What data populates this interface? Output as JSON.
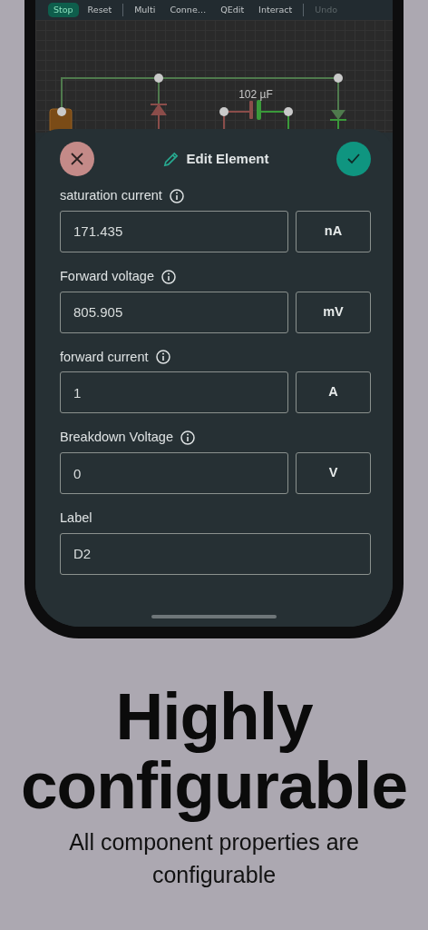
{
  "toolbar": {
    "groups": [
      [
        {
          "label": "Stop",
          "selected": true,
          "disabled": false
        },
        {
          "label": "Reset",
          "selected": false,
          "disabled": false
        }
      ],
      [
        {
          "label": "Multi",
          "selected": false,
          "disabled": false
        },
        {
          "label": "Conne…",
          "selected": false,
          "disabled": false
        },
        {
          "label": "QEdit",
          "selected": false,
          "disabled": false
        },
        {
          "label": "Interact",
          "selected": false,
          "disabled": false
        }
      ],
      [
        {
          "label": "Undo",
          "selected": false,
          "disabled": true
        }
      ]
    ]
  },
  "circuit": {
    "capacitor_label": "102 µF"
  },
  "dialog": {
    "title": "Edit Element",
    "fields": [
      {
        "label": "saturation current",
        "info": true,
        "value": "171.435",
        "unit": "nA"
      },
      {
        "label": "Forward voltage",
        "info": true,
        "value": "805.905",
        "unit": "mV"
      },
      {
        "label": "forward current",
        "info": true,
        "value": "1",
        "unit": "A"
      },
      {
        "label": "Breakdown Voltage",
        "info": true,
        "value": "0",
        "unit": "V"
      },
      {
        "label": "Label",
        "info": false,
        "value": "D2"
      }
    ]
  },
  "headline": "Highly configurable",
  "subtitle": "All component properties are configurable"
}
